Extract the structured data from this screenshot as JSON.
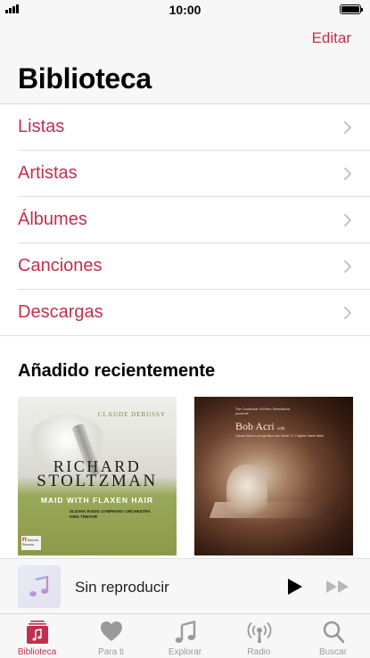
{
  "status_bar": {
    "time": "10:00"
  },
  "header": {
    "edit_label": "Editar",
    "title": "Biblioteca"
  },
  "library": {
    "items": [
      {
        "label": "Listas"
      },
      {
        "label": "Artistas"
      },
      {
        "label": "Álbumes"
      },
      {
        "label": "Canciones"
      },
      {
        "label": "Descargas"
      }
    ]
  },
  "recently_added": {
    "title": "Añadido recientemente",
    "albums": [
      {
        "composer": "CLAUDE DEBUSSY",
        "artist_line1": "RICHARD",
        "artist_line2": "STOLTZMAN",
        "title": "MAID WITH FLAXEN HAIR",
        "orchestra": "SLOVAK RADIO SYMPHONY ORCHESTRA",
        "conductor": "KIRK TREVOR",
        "label_text": "Navona Records"
      },
      {
        "presenter": "The Cavalcade of Piano Simulations presents",
        "artist": "Bob Acri",
        "artist_suffix": "with",
        "subtitle": "Chicas Gritos Lemngs Misc Like Solaff: 12 Thighter Haefe Metis"
      }
    ]
  },
  "mini_player": {
    "status": "Sin reproducir"
  },
  "tab_bar": {
    "tabs": [
      {
        "label": "Biblioteca",
        "icon": "library-icon",
        "active": true
      },
      {
        "label": "Para ti",
        "icon": "heart-icon",
        "active": false
      },
      {
        "label": "Explorar",
        "icon": "music-note-icon",
        "active": false
      },
      {
        "label": "Radio",
        "icon": "radio-icon",
        "active": false
      },
      {
        "label": "Buscar",
        "icon": "search-icon",
        "active": false
      }
    ]
  },
  "colors": {
    "accent": "#c0304e",
    "inactive": "#9a9a9a",
    "bar_background": "#f7f7f7"
  }
}
